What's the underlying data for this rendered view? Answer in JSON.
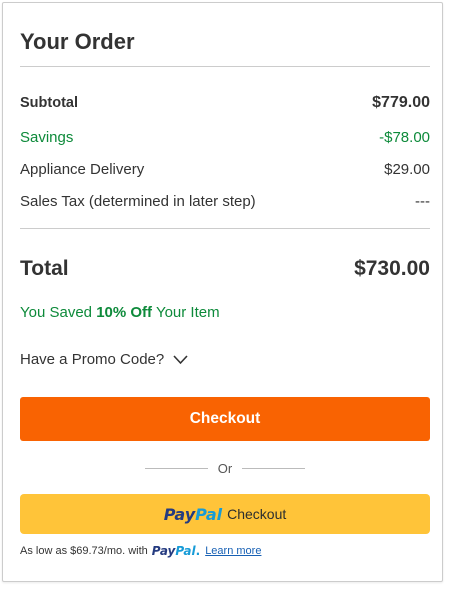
{
  "order": {
    "title": "Your Order",
    "subtotal": {
      "label": "Subtotal",
      "value": "$779.00"
    },
    "savings": {
      "label": "Savings",
      "value": "-$78.00"
    },
    "delivery": {
      "label": "Appliance Delivery",
      "value": "$29.00"
    },
    "tax": {
      "label": "Sales Tax (determined in later step)",
      "value": "---"
    },
    "total": {
      "label": "Total",
      "value": "$730.00"
    },
    "saved_message": {
      "prefix": "You Saved ",
      "highlight": "10% Off",
      "suffix": " Your Item"
    },
    "promo_label": "Have a Promo Code?"
  },
  "actions": {
    "checkout_label": "Checkout",
    "or_label": "Or",
    "paypal_logo_part1": "Pay",
    "paypal_logo_part2": "Pal",
    "paypal_checkout_label": "Checkout"
  },
  "financing": {
    "prefix": "As low as $69.73/mo. with",
    "paypal_logo_part1": "Pay",
    "paypal_logo_part2": "Pal",
    "paypal_logo_dot": ".",
    "learn_more": "Learn more"
  },
  "colors": {
    "accent_orange": "#f96302",
    "savings_green": "#0d8a3a",
    "paypal_yellow": "#ffc439",
    "paypal_dark_blue": "#253b80",
    "paypal_light_blue": "#179bd7",
    "link_blue": "#1760b4"
  },
  "icons": {
    "promo_toggle": "chevron-down-icon"
  }
}
